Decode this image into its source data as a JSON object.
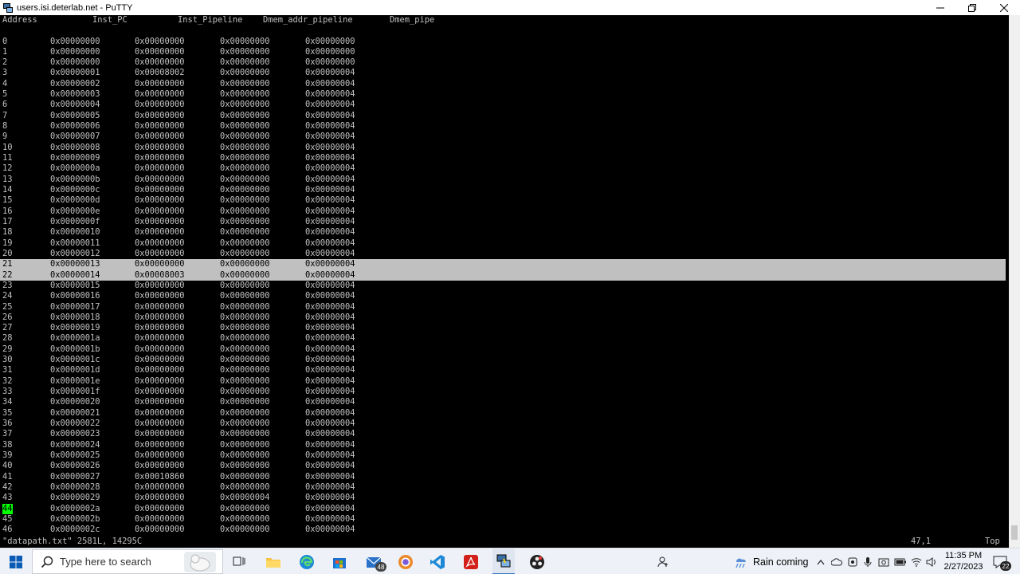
{
  "window": {
    "title": "users.isi.deterlab.net - PuTTY"
  },
  "terminal": {
    "headers": [
      "Address",
      "Inst_PC",
      "Inst_Pipeline",
      "Dmem_addr_pipeline",
      "Dmem_pipe"
    ],
    "rows": [
      [
        "0",
        "0x00000000",
        "0x00000000",
        "0x00000000",
        "0x00000000"
      ],
      [
        "1",
        "0x00000000",
        "0x00000000",
        "0x00000000",
        "0x00000000"
      ],
      [
        "2",
        "0x00000000",
        "0x00000000",
        "0x00000000",
        "0x00000000"
      ],
      [
        "3",
        "0x00000001",
        "0x00008002",
        "0x00000000",
        "0x00000004"
      ],
      [
        "4",
        "0x00000002",
        "0x00000000",
        "0x00000000",
        "0x00000004"
      ],
      [
        "5",
        "0x00000003",
        "0x00000000",
        "0x00000000",
        "0x00000004"
      ],
      [
        "6",
        "0x00000004",
        "0x00000000",
        "0x00000000",
        "0x00000004"
      ],
      [
        "7",
        "0x00000005",
        "0x00000000",
        "0x00000000",
        "0x00000004"
      ],
      [
        "8",
        "0x00000006",
        "0x00000000",
        "0x00000000",
        "0x00000004"
      ],
      [
        "9",
        "0x00000007",
        "0x00000000",
        "0x00000000",
        "0x00000004"
      ],
      [
        "10",
        "0x00000008",
        "0x00000000",
        "0x00000000",
        "0x00000004"
      ],
      [
        "11",
        "0x00000009",
        "0x00000000",
        "0x00000000",
        "0x00000004"
      ],
      [
        "12",
        "0x0000000a",
        "0x00000000",
        "0x00000000",
        "0x00000004"
      ],
      [
        "13",
        "0x0000000b",
        "0x00000000",
        "0x00000000",
        "0x00000004"
      ],
      [
        "14",
        "0x0000000c",
        "0x00000000",
        "0x00000000",
        "0x00000004"
      ],
      [
        "15",
        "0x0000000d",
        "0x00000000",
        "0x00000000",
        "0x00000004"
      ],
      [
        "16",
        "0x0000000e",
        "0x00000000",
        "0x00000000",
        "0x00000004"
      ],
      [
        "17",
        "0x0000000f",
        "0x00000000",
        "0x00000000",
        "0x00000004"
      ],
      [
        "18",
        "0x00000010",
        "0x00000000",
        "0x00000000",
        "0x00000004"
      ],
      [
        "19",
        "0x00000011",
        "0x00000000",
        "0x00000000",
        "0x00000004"
      ],
      [
        "20",
        "0x00000012",
        "0x00000000",
        "0x00000000",
        "0x00000004"
      ],
      [
        "21",
        "0x00000013",
        "0x00000000",
        "0x00000000",
        "0x00000004"
      ],
      [
        "22",
        "0x00000014",
        "0x00008003",
        "0x00000000",
        "0x00000004"
      ],
      [
        "23",
        "0x00000015",
        "0x00000000",
        "0x00000000",
        "0x00000004"
      ],
      [
        "24",
        "0x00000016",
        "0x00000000",
        "0x00000000",
        "0x00000004"
      ],
      [
        "25",
        "0x00000017",
        "0x00000000",
        "0x00000000",
        "0x00000004"
      ],
      [
        "26",
        "0x00000018",
        "0x00000000",
        "0x00000000",
        "0x00000004"
      ],
      [
        "27",
        "0x00000019",
        "0x00000000",
        "0x00000000",
        "0x00000004"
      ],
      [
        "28",
        "0x0000001a",
        "0x00000000",
        "0x00000000",
        "0x00000004"
      ],
      [
        "29",
        "0x0000001b",
        "0x00000000",
        "0x00000000",
        "0x00000004"
      ],
      [
        "30",
        "0x0000001c",
        "0x00000000",
        "0x00000000",
        "0x00000004"
      ],
      [
        "31",
        "0x0000001d",
        "0x00000000",
        "0x00000000",
        "0x00000004"
      ],
      [
        "32",
        "0x0000001e",
        "0x00000000",
        "0x00000000",
        "0x00000004"
      ],
      [
        "33",
        "0x0000001f",
        "0x00000000",
        "0x00000000",
        "0x00000004"
      ],
      [
        "34",
        "0x00000020",
        "0x00000000",
        "0x00000000",
        "0x00000004"
      ],
      [
        "35",
        "0x00000021",
        "0x00000000",
        "0x00000000",
        "0x00000004"
      ],
      [
        "36",
        "0x00000022",
        "0x00000000",
        "0x00000000",
        "0x00000004"
      ],
      [
        "37",
        "0x00000023",
        "0x00000000",
        "0x00000000",
        "0x00000004"
      ],
      [
        "38",
        "0x00000024",
        "0x00000000",
        "0x00000000",
        "0x00000004"
      ],
      [
        "39",
        "0x00000025",
        "0x00000000",
        "0x00000000",
        "0x00000004"
      ],
      [
        "40",
        "0x00000026",
        "0x00000000",
        "0x00000000",
        "0x00000004"
      ],
      [
        "41",
        "0x00000027",
        "0x00010860",
        "0x00000000",
        "0x00000004"
      ],
      [
        "42",
        "0x00000028",
        "0x00000000",
        "0x00000000",
        "0x00000004"
      ],
      [
        "43",
        "0x00000029",
        "0x00000000",
        "0x00000004",
        "0x00000004"
      ],
      [
        "44",
        "0x0000002a",
        "0x00000000",
        "0x00000000",
        "0x00000004"
      ],
      [
        "45",
        "0x0000002b",
        "0x00000000",
        "0x00000000",
        "0x00000004"
      ],
      [
        "46",
        "0x0000002c",
        "0x00000000",
        "0x00000000",
        "0x00000004"
      ]
    ],
    "selected_rows": [
      21,
      22
    ],
    "status": {
      "file": "\"datapath.txt\" 2581L, 14295C",
      "position": "47,1",
      "scroll": "Top"
    }
  },
  "taskbar": {
    "search_placeholder": "Type here to search",
    "mail_badge": "48",
    "weather": "Rain coming",
    "time": "11:35 PM",
    "date": "2/27/2023",
    "notification_count": "22"
  },
  "colors": {
    "terminal_bg": "#000000",
    "terminal_fg": "#c0c0c0",
    "selection_bg": "#c0c0c0",
    "cursor": "#00ff00"
  }
}
